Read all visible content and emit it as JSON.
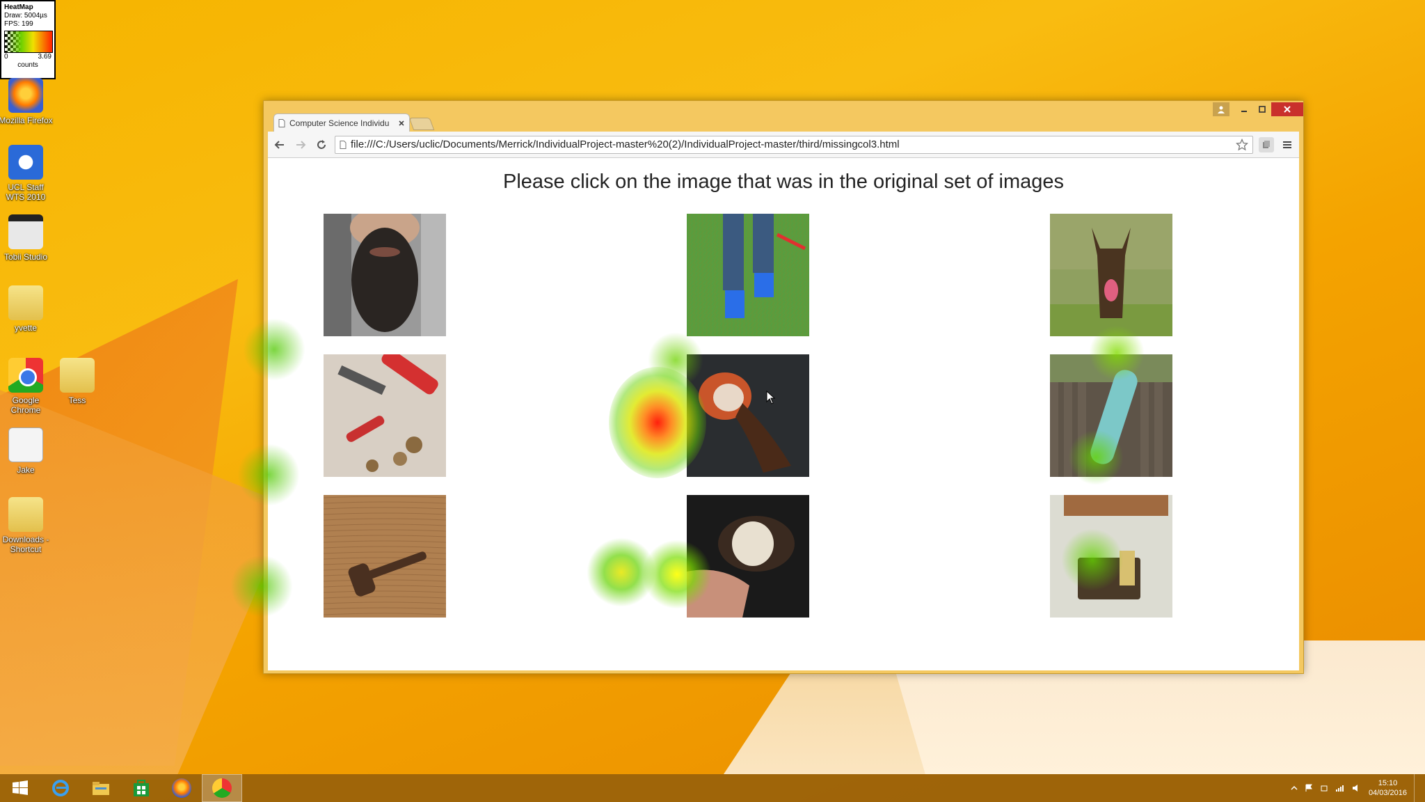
{
  "heatmap_legend": {
    "title": "HeatMap",
    "draw": "Draw: 5004µs",
    "fps": "FPS: 199",
    "min": "0",
    "max": "3.69",
    "unit": "counts"
  },
  "desktop_icons": [
    {
      "label": "Mozilla Firefox",
      "icon": "firefox-icon"
    },
    {
      "label": "UCL Staff WTS 2010",
      "icon": "remote-desktop-icon"
    },
    {
      "label": "Tobii Studio",
      "icon": "tobii-studio-icon"
    },
    {
      "label": "yvette",
      "icon": "folder-icon"
    },
    {
      "label": "Google Chrome",
      "icon": "chrome-icon"
    },
    {
      "label": "Tess",
      "icon": "folder-icon"
    },
    {
      "label": "Jake",
      "icon": "document-icon"
    },
    {
      "label": "Downloads - Shortcut",
      "icon": "downloads-folder-icon"
    }
  ],
  "browser": {
    "tab_title": "Computer Science Individu",
    "url": "file:///C:/Users/uclic/Documents/Merrick/IndividualProject-master%20(2)/IndividualProject-master/third/missingcol3.html"
  },
  "page": {
    "heading": "Please click on the image that was in the original set of images",
    "images": [
      {
        "subject": "beard"
      },
      {
        "subject": "legs-on-grass"
      },
      {
        "subject": "dog"
      },
      {
        "subject": "tools-and-nuts"
      },
      {
        "subject": "coffee-beans"
      },
      {
        "subject": "skateboard"
      },
      {
        "subject": "gavel"
      },
      {
        "subject": "radio-dial"
      },
      {
        "subject": "wallet-in-pocket"
      }
    ]
  },
  "taskbar": {
    "apps": [
      "start-icon",
      "internet-explorer-icon",
      "file-explorer-icon",
      "store-icon",
      "firefox-icon",
      "chrome-icon"
    ],
    "time": "15:10",
    "date": "04/03/2016"
  },
  "colors": {
    "desktop": "#f6b400",
    "taskbar": "#965f0a",
    "close_button": "#c9302c"
  }
}
